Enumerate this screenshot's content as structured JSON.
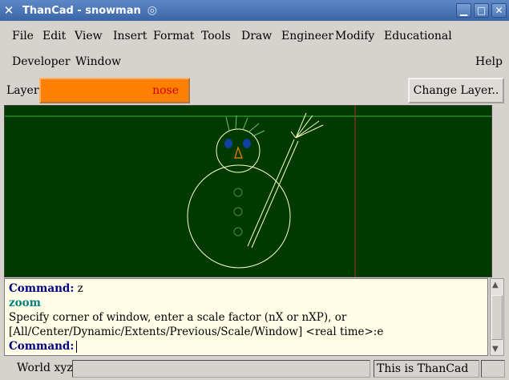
{
  "window": {
    "title": "ThanCad - snowman"
  },
  "menu": {
    "row1": [
      "File",
      "Edit",
      "View",
      "Insert",
      "Format",
      "Tools",
      "Draw",
      "Engineer",
      "Modify",
      "Educational"
    ],
    "row2": [
      "Developer",
      "Window"
    ],
    "help": "Help"
  },
  "layer": {
    "label": "Layer:",
    "current": "nose",
    "current_color": "#ff8000",
    "change_button": "Change Layer.."
  },
  "canvas": {
    "background": "#003a00",
    "stroke_color": "#ffffc0",
    "crosshair_color": "#b03030"
  },
  "console": {
    "line1_label": "Command:",
    "line1_value": " z",
    "line2": "zoom",
    "line3": "Specify corner of window, enter a scale factor (nX or nXP), or",
    "line4": "[All/Center/Dynamic/Extents/Previous/Scale/Window] <real time>:e",
    "line5_label": "Command:"
  },
  "status": {
    "world_label": "World xyz:",
    "message": "This is ThanCad"
  }
}
